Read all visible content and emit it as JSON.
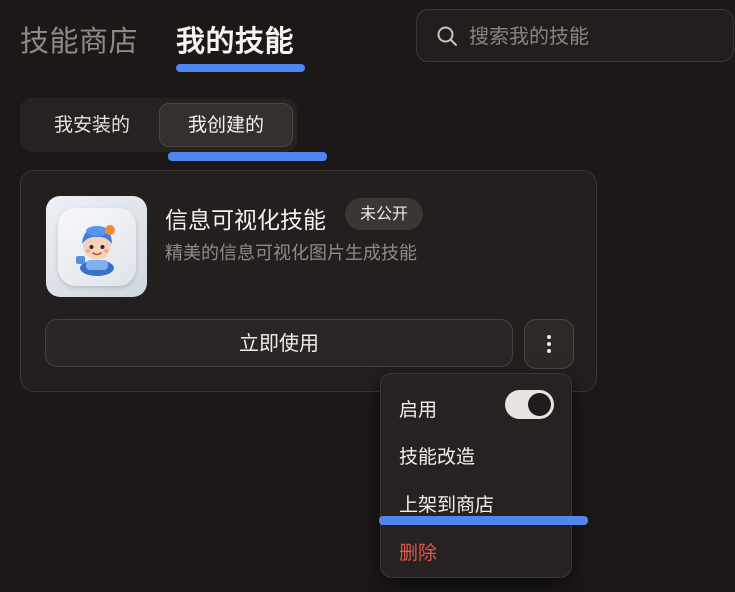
{
  "tabs": {
    "store": "技能商店",
    "mine": "我的技能"
  },
  "search": {
    "placeholder": "搜索我的技能"
  },
  "segments": {
    "installed": "我安装的",
    "created": "我创建的"
  },
  "skill": {
    "name": "信息可视化技能",
    "badge": "未公开",
    "description": "精美的信息可视化图片生成技能",
    "use_label": "立即使用"
  },
  "menu": {
    "enable_label": "启用",
    "enable_on": true,
    "modify_label": "技能改造",
    "publish_label": "上架到商店",
    "delete_label": "删除"
  },
  "colors": {
    "accent": "#4f87f2",
    "danger": "#e0574a",
    "background": "#1b1817"
  }
}
